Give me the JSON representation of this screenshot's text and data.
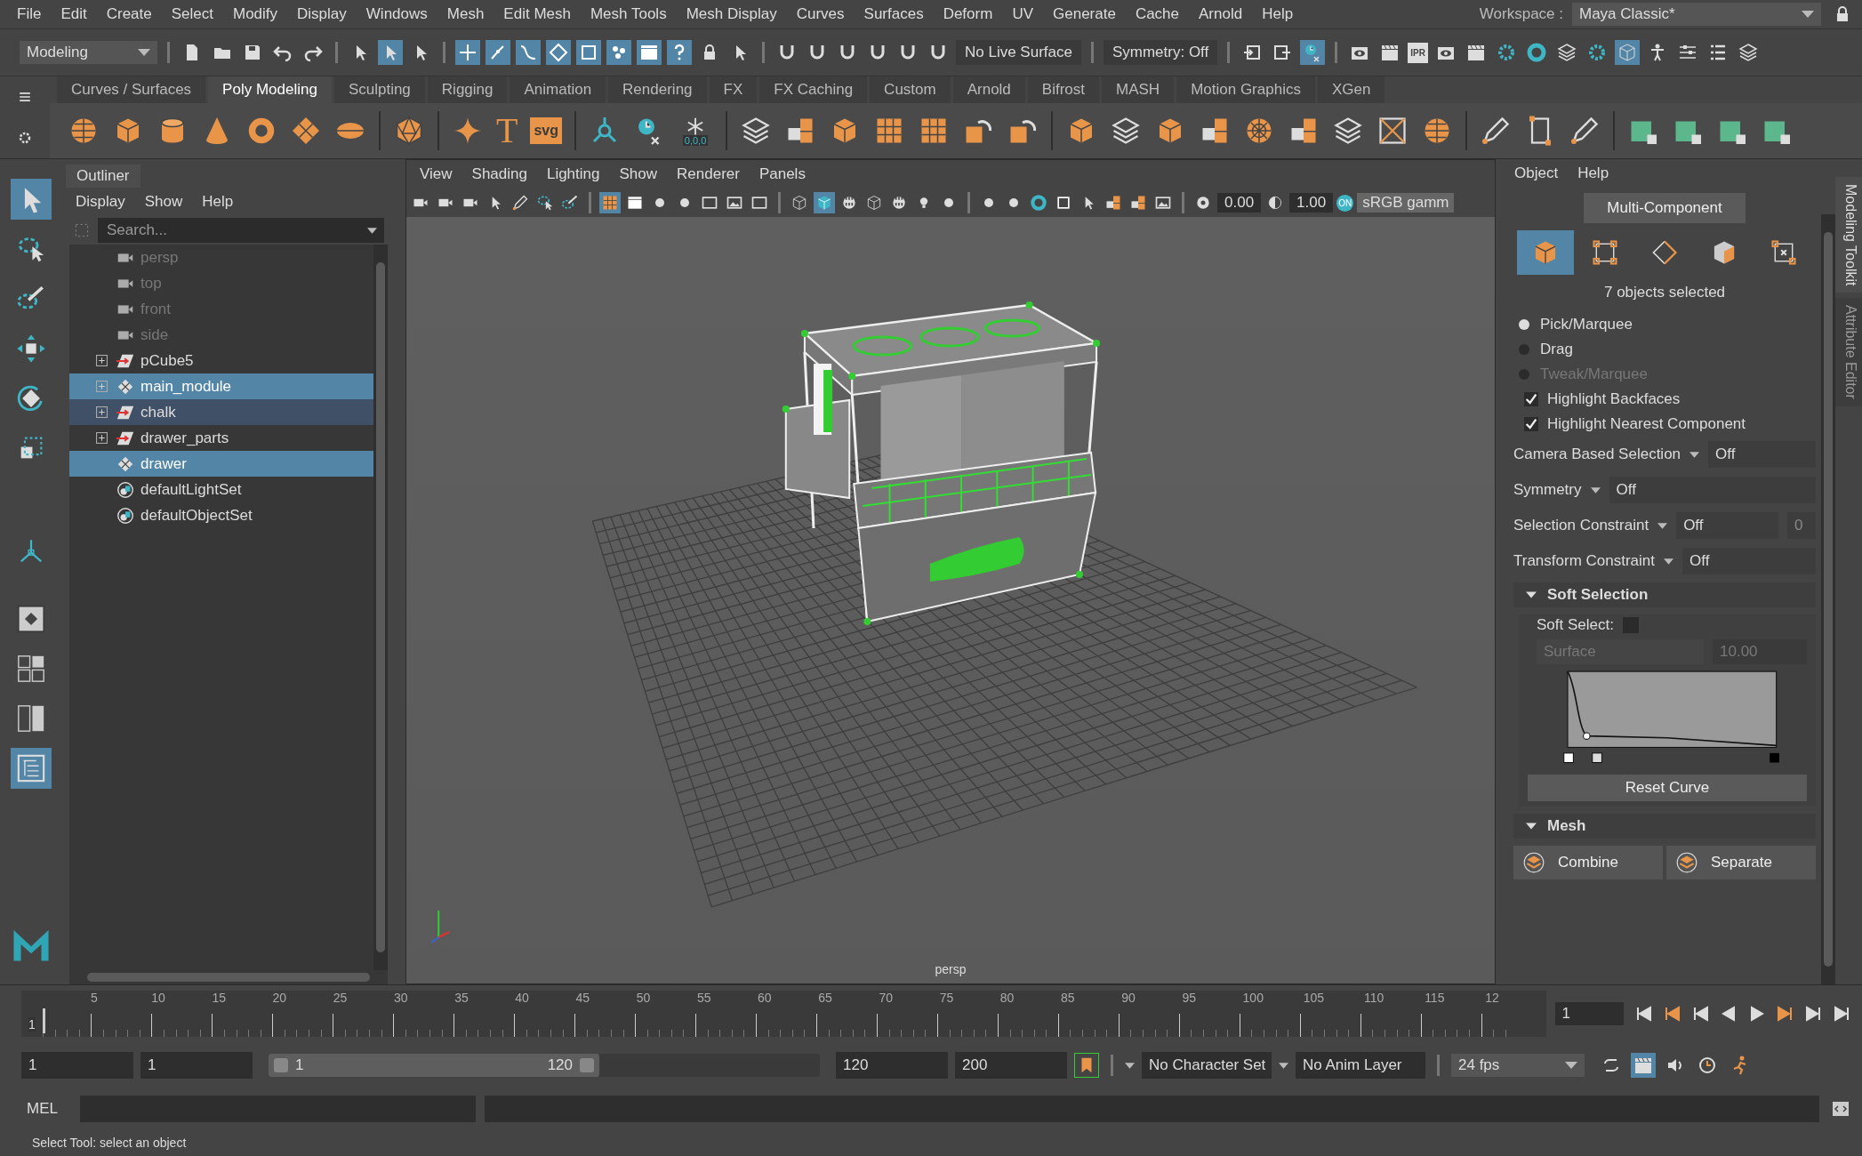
{
  "menu_bar": [
    "File",
    "Edit",
    "Create",
    "Select",
    "Modify",
    "Display",
    "Windows",
    "Mesh",
    "Edit Mesh",
    "Mesh Tools",
    "Mesh Display",
    "Curves",
    "Surfaces",
    "Deform",
    "UV",
    "Generate",
    "Cache",
    "Arnold",
    "Help"
  ],
  "workspace": {
    "label": "Workspace :",
    "value": "Maya Classic*"
  },
  "status_line": {
    "menu_set": "Modeling",
    "live_surface": "No Live Surface",
    "symmetry": "Symmetry: Off",
    "ipr_label": "IPR",
    "selection_masks": [
      {
        "kind": "plus",
        "on": true
      },
      {
        "kind": "joint",
        "on": true
      },
      {
        "kind": "curve",
        "on": true
      },
      {
        "kind": "diamond",
        "on": true
      },
      {
        "kind": "square",
        "on": true
      },
      {
        "kind": "dots",
        "on": true
      },
      {
        "kind": "film",
        "on": true
      },
      {
        "kind": "question",
        "on": true
      }
    ]
  },
  "shelf_tabs": [
    {
      "label": "Curves / Surfaces",
      "selected": false
    },
    {
      "label": "Poly Modeling",
      "selected": true
    },
    {
      "label": "Sculpting",
      "selected": false
    },
    {
      "label": "Rigging",
      "selected": false
    },
    {
      "label": "Animation",
      "selected": false
    },
    {
      "label": "Rendering",
      "selected": false
    },
    {
      "label": "FX",
      "selected": false
    },
    {
      "label": "FX Caching",
      "selected": false
    },
    {
      "label": "Custom",
      "selected": false
    },
    {
      "label": "Arnold",
      "selected": false
    },
    {
      "label": "Bifrost",
      "selected": false
    },
    {
      "label": "MASH",
      "selected": false
    },
    {
      "label": "Motion Graphics",
      "selected": false
    },
    {
      "label": "XGen",
      "selected": false
    }
  ],
  "shelf": {
    "text_tool_glyph": "T",
    "svg_tool_label": "svg",
    "freeze_tool_label": "0,0,0"
  },
  "toolbox": [
    {
      "kind": "select",
      "selected": true
    },
    {
      "kind": "lasso",
      "selected": false
    },
    {
      "kind": "paint",
      "selected": false
    },
    {
      "kind": "move",
      "selected": false
    },
    {
      "kind": "rotate",
      "selected": false
    },
    {
      "kind": "scale",
      "selected": false
    },
    {
      "kind": "manip",
      "selected": false
    },
    {
      "kind": "single",
      "selected": false
    },
    {
      "kind": "four",
      "selected": false
    },
    {
      "kind": "two",
      "selected": false
    },
    {
      "kind": "outliner",
      "selected": true
    }
  ],
  "outliner": {
    "title": "Outliner",
    "menu": [
      "Display",
      "Show",
      "Help"
    ],
    "search": {
      "placeholder": "Search..."
    },
    "items": [
      {
        "name": "persp",
        "kind": "camera",
        "has_children": false,
        "dimmed": true,
        "selected": false,
        "highlighted": false
      },
      {
        "name": "top",
        "kind": "camera",
        "has_children": false,
        "dimmed": true,
        "selected": false,
        "highlighted": false
      },
      {
        "name": "front",
        "kind": "camera",
        "has_children": false,
        "dimmed": true,
        "selected": false,
        "highlighted": false
      },
      {
        "name": "side",
        "kind": "camera",
        "has_children": false,
        "dimmed": true,
        "selected": false,
        "highlighted": false
      },
      {
        "name": "pCube5",
        "kind": "transform",
        "has_children": true,
        "dimmed": false,
        "selected": false,
        "highlighted": false
      },
      {
        "name": "main_module",
        "kind": "mesh",
        "has_children": true,
        "dimmed": false,
        "selected": true,
        "highlighted": false
      },
      {
        "name": "chalk",
        "kind": "transform",
        "has_children": true,
        "dimmed": false,
        "selected": false,
        "highlighted": true
      },
      {
        "name": "drawer_parts",
        "kind": "transform",
        "has_children": true,
        "dimmed": false,
        "selected": false,
        "highlighted": false
      },
      {
        "name": "drawer",
        "kind": "mesh",
        "has_children": false,
        "dimmed": false,
        "selected": true,
        "highlighted": false
      },
      {
        "name": "defaultLightSet",
        "kind": "set",
        "has_children": false,
        "dimmed": false,
        "selected": false,
        "highlighted": false
      },
      {
        "name": "defaultObjectSet",
        "kind": "set",
        "has_children": false,
        "dimmed": false,
        "selected": false,
        "highlighted": false
      }
    ]
  },
  "viewport": {
    "menu": [
      "View",
      "Shading",
      "Lighting",
      "Show",
      "Renderer",
      "Panels"
    ],
    "exposure": "0.00",
    "gamma": "1.00",
    "color_toggle": "ON",
    "color_space": "sRGB gamm",
    "camera": "persp"
  },
  "modeling_toolkit": {
    "menu": [
      "Object",
      "Help"
    ],
    "mode": "Multi-Component",
    "components": [
      {
        "kind": "object",
        "selected": true
      },
      {
        "kind": "vertex",
        "selected": false
      },
      {
        "kind": "edge",
        "selected": false
      },
      {
        "kind": "face",
        "selected": false
      },
      {
        "kind": "uv",
        "selected": false
      }
    ],
    "status": "7 objects selected",
    "pick_modes": [
      {
        "label": "Pick/Marquee",
        "selected": true,
        "disabled": false
      },
      {
        "label": "Drag",
        "selected": false,
        "disabled": false
      },
      {
        "label": "Tweak/Marquee",
        "selected": false,
        "disabled": true
      }
    ],
    "checkboxes": [
      {
        "label": "Highlight Backfaces",
        "checked": true
      },
      {
        "label": "Highlight Nearest Component",
        "checked": true
      }
    ],
    "dropdowns": [
      {
        "label": "Camera Based Selection",
        "value": "Off"
      },
      {
        "label": "Symmetry",
        "value": "Off"
      },
      {
        "label": "Selection Constraint",
        "value": "Off",
        "extra": "0"
      },
      {
        "label": "Transform Constraint",
        "value": "Off"
      }
    ],
    "soft_selection": {
      "title": "Soft Selection",
      "expanded": true,
      "soft_select_label": "Soft Select:",
      "checked": false,
      "falloff": "Surface",
      "radius": "10.00",
      "reset": "Reset Curve"
    },
    "mesh": {
      "title": "Mesh",
      "expanded": true,
      "buttons": [
        "Combine",
        "Separate"
      ]
    }
  },
  "side_tabs": [
    {
      "label": "Modeling Toolkit",
      "selected": true
    },
    {
      "label": "Attribute Editor",
      "selected": false
    }
  ],
  "timeline": {
    "current": "1",
    "level": 0,
    "ticks": [
      "5",
      "10",
      "15",
      "20",
      "25",
      "30",
      "35",
      "40",
      "45",
      "50",
      "55",
      "60",
      "65",
      "70",
      "75",
      "80",
      "85",
      "90",
      "95",
      "100",
      "105",
      "110",
      "115",
      "12"
    ],
    "frame_field": "1"
  },
  "range": {
    "level": 0.6,
    "start": "1",
    "playback_start": "1",
    "slider_start": "1",
    "slider_end": "120",
    "playback_end": "120",
    "end": "200",
    "character_set": "No Character Set",
    "anim_layer": "No Anim Layer",
    "fps": "24 fps"
  },
  "command_line": {
    "language": "MEL"
  },
  "help_line": "Select Tool: select an object"
}
